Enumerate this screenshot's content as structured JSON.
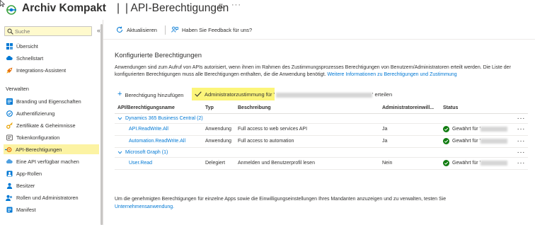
{
  "header": {
    "app_title": "Archiv Kompakt",
    "separator": "|",
    "page_title": "| API-Berechtigungen",
    "more": "···"
  },
  "sidebar": {
    "search_placeholder": "Suche",
    "collapse": "«",
    "items_top": [
      {
        "label": "Übersicht",
        "icon": "grid-icon"
      },
      {
        "label": "Schnellstart",
        "icon": "cloud-icon"
      },
      {
        "label": "Integrations-Assistent",
        "icon": "rocket-icon"
      }
    ],
    "section_label": "Verwalten",
    "items_manage": [
      {
        "label": "Branding und Eigenschaften",
        "icon": "branding-icon"
      },
      {
        "label": "Authentifizierung",
        "icon": "auth-icon"
      },
      {
        "label": "Zertifikate & Geheimnisse",
        "icon": "key-icon"
      },
      {
        "label": "Tokenkonfiguration",
        "icon": "token-icon"
      },
      {
        "label": "API-Berechtigungen",
        "icon": "api-permissions-icon"
      },
      {
        "label": "Eine API verfügbar machen",
        "icon": "cloud-api-icon"
      },
      {
        "label": "App-Rollen",
        "icon": "app-roles-icon"
      },
      {
        "label": "Besitzer",
        "icon": "owner-icon"
      },
      {
        "label": "Rollen und Administratoren",
        "icon": "admin-roles-icon"
      },
      {
        "label": "Manifest",
        "icon": "manifest-icon"
      }
    ]
  },
  "toolbar": {
    "refresh_label": "Aktualisieren",
    "feedback_label": "Haben Sie Feedback für uns?"
  },
  "main": {
    "section_title": "Konfigurierte Berechtigungen",
    "description": "Anwendungen sind zum Aufruf von APIs autorisiert, wenn ihnen im Rahmen des Zustimmungsprozesses Berechtigungen von Benutzern/Administratoren erteilt werden. Die Liste der konfigurierten Berechtigungen muss alle Berechtigungen enthalten, die die Anwendung benötigt.",
    "description_link": "Weitere Informationen zu Berechtigungen und Zustimmung",
    "add_permission_label": "Berechtigung hinzufügen",
    "admin_consent_label": "Administratorzustimmung für '",
    "admin_consent_suffix": "' erteilen",
    "table": {
      "headers": [
        "API/Berechtigungsname",
        "Typ",
        "Beschreibung",
        "Administratoreinwill...",
        "Status"
      ],
      "groups": [
        {
          "name": "Dynamics 365 Business Central (2)",
          "rows": [
            {
              "name": "API.ReadWrite.All",
              "type": "Anwendung",
              "description": "Full access to web services API",
              "admin": "Ja",
              "status": "Gewährt für '"
            },
            {
              "name": "Automation.ReadWrite.All",
              "type": "Anwendung",
              "description": "Full access to automation",
              "admin": "Ja",
              "status": "Gewährt für '"
            }
          ]
        },
        {
          "name": "Microsoft Graph (1)",
          "rows": [
            {
              "name": "User.Read",
              "type": "Delegiert",
              "description": "Anmelden und Benutzerprofil lesen",
              "admin": "Nein",
              "status": "Gewährt für '"
            }
          ]
        }
      ],
      "row_more": "···"
    },
    "footer_text": "Um die genehmigten Berechtigungen für einzelne Apps sowie die Einwilligungseinstellungen Ihres Mandanten anzuzeigen und zu verwalten, testen Sie",
    "footer_link": "Unternehmensanwendung."
  },
  "colors": {
    "accent": "#0078d4",
    "highlight": "#fcf57a",
    "success": "#107c10"
  }
}
